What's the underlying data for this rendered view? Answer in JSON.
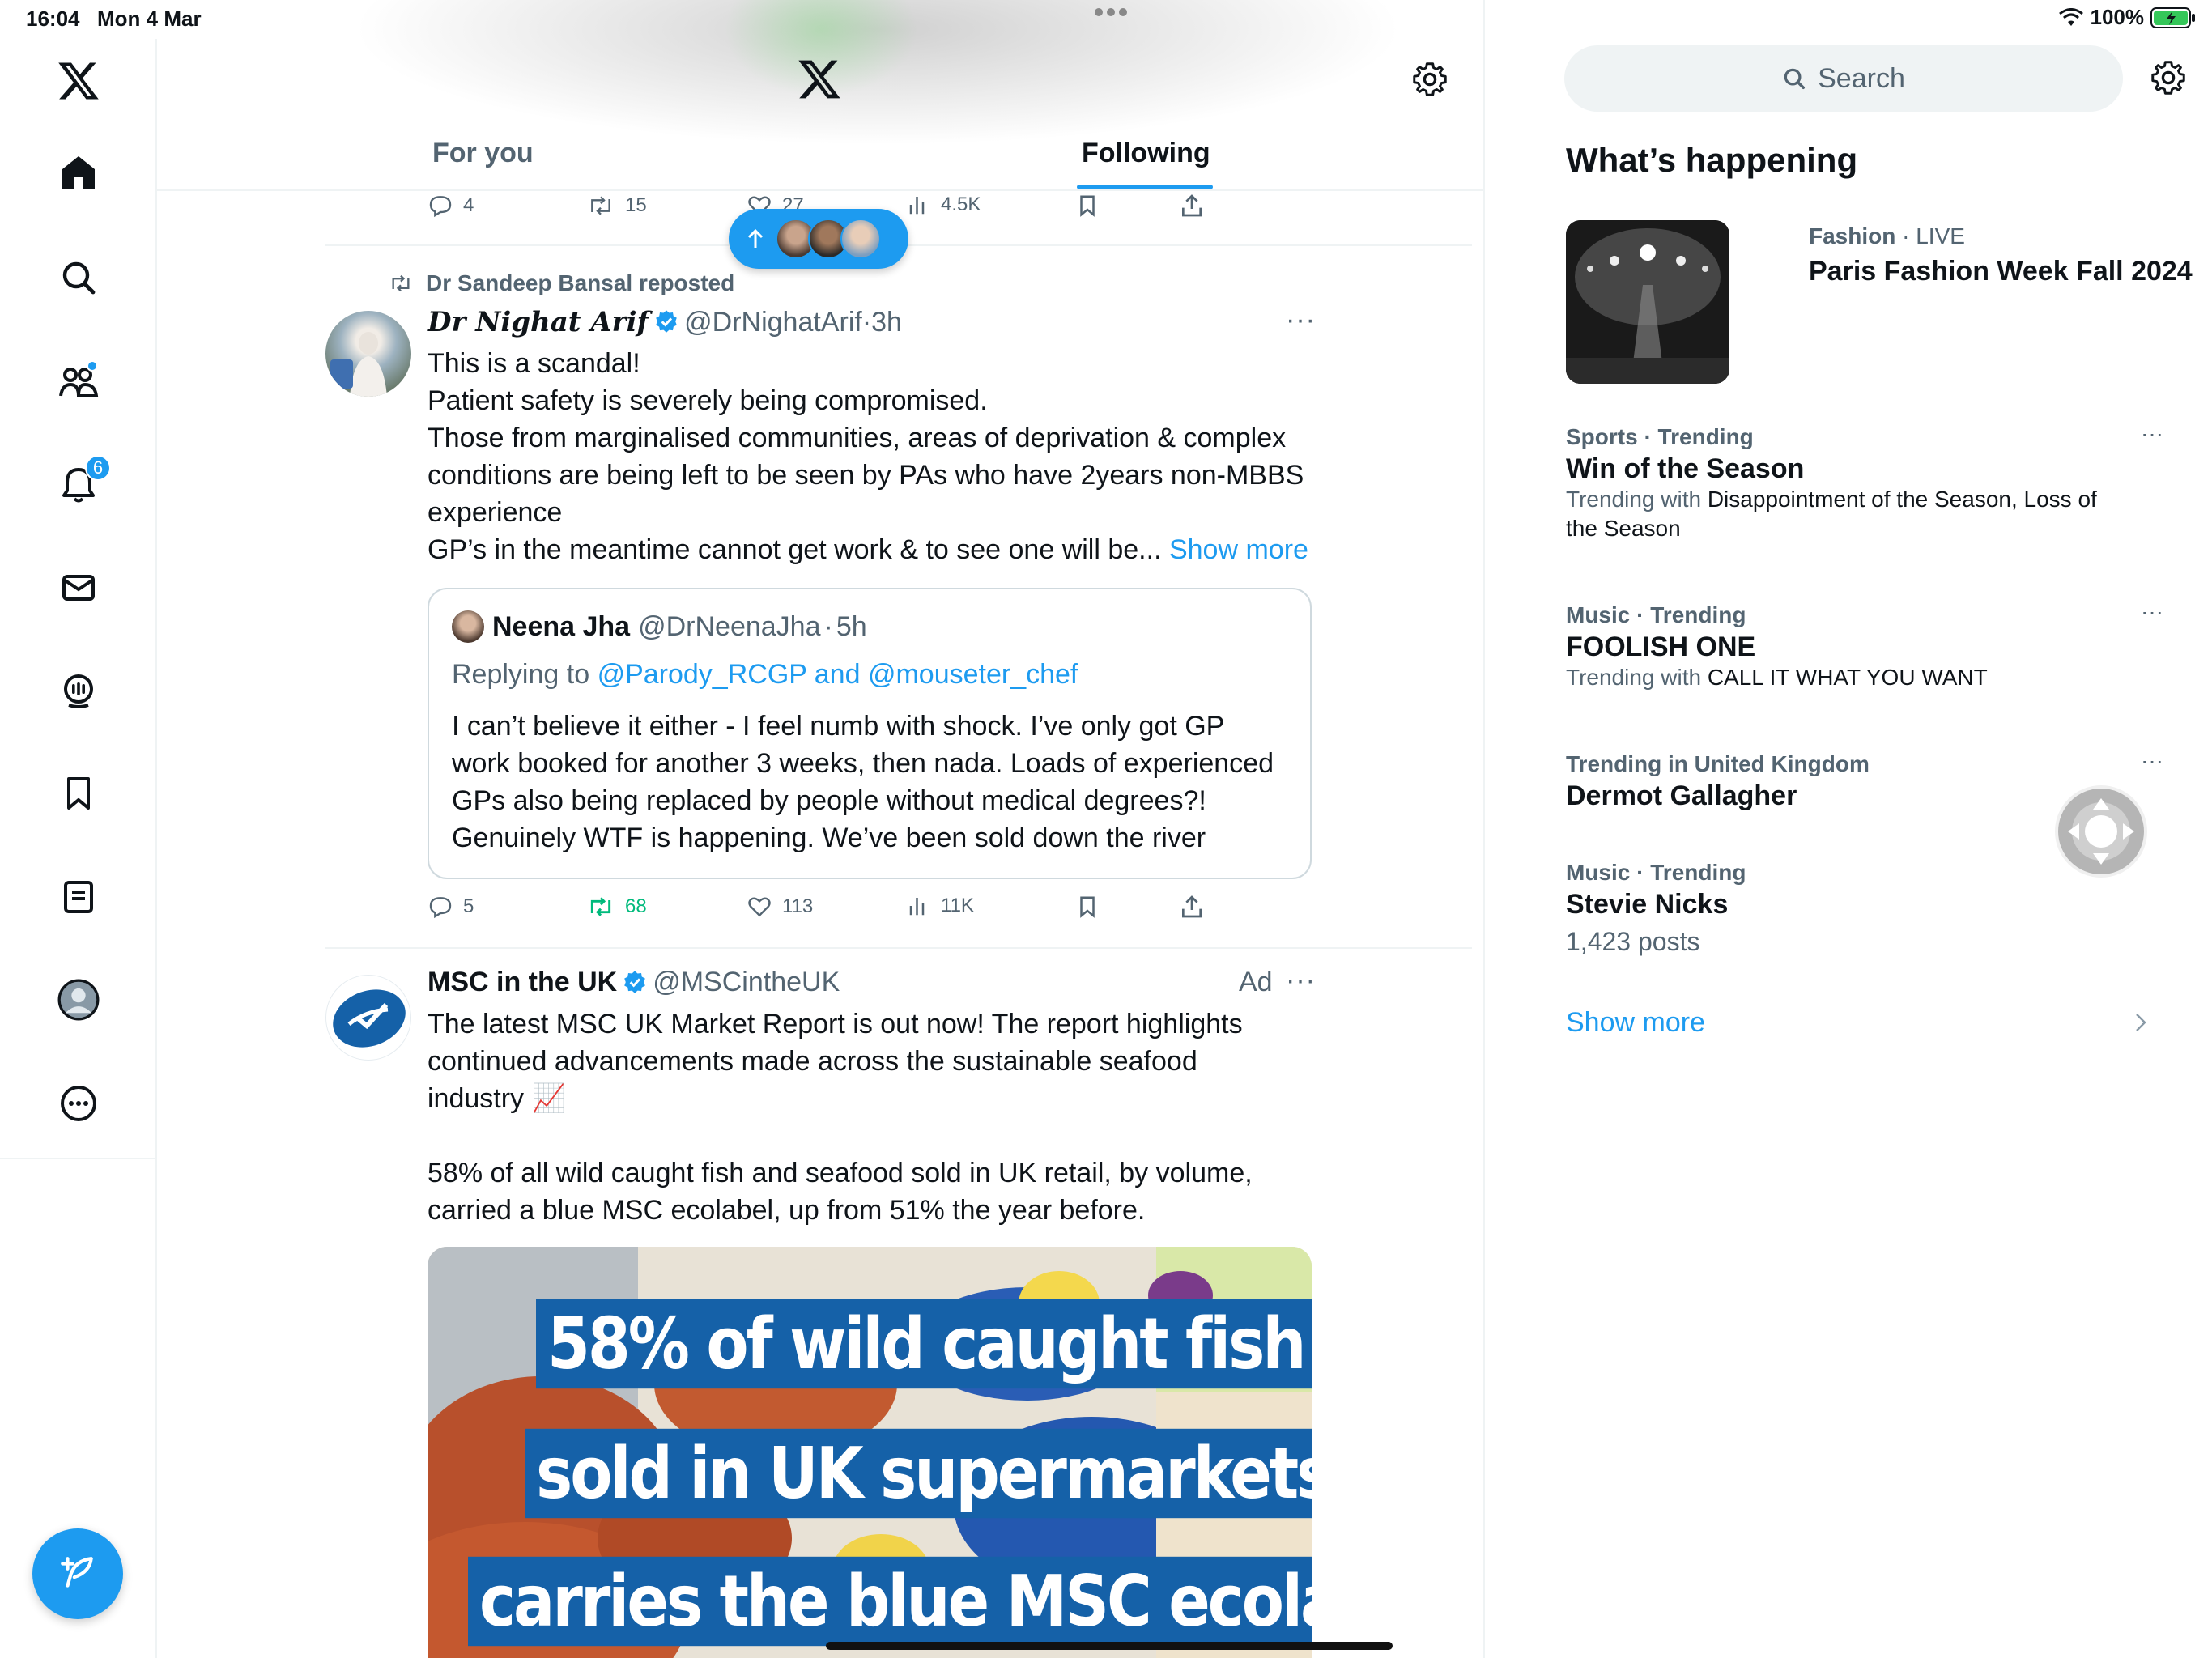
{
  "status_bar": {
    "time": "16:04",
    "date": "Mon 4 Mar",
    "battery": "100%"
  },
  "nav": {
    "notifications_badge": "6"
  },
  "header": {
    "tabs": [
      {
        "label": "For you",
        "selected": false
      },
      {
        "label": "Following",
        "selected": true
      }
    ]
  },
  "feed": {
    "prev_actions": {
      "replies": "4",
      "reposts": "15",
      "likes": "27",
      "views": "4.5K"
    },
    "tweet1": {
      "repost_label": "Dr Sandeep Bansal reposted",
      "name": "Dr Nighat Arif",
      "handle": "@DrNighatArif",
      "time": "3h",
      "lines": [
        "This is a scandal!",
        "Patient safety is severely being compromised.",
        "Those from marginalised communities, areas of deprivation & complex",
        "conditions are being left to be seen by PAs who have 2years non-MBBS",
        "experience",
        "GP’s in the meantime cannot get work & to see one will be..."
      ],
      "show_more": "Show more",
      "quote": {
        "name": "Neena Jha",
        "handle": "@DrNeenaJha",
        "time": "5h",
        "replying_prefix": "Replying to",
        "replying_to": "@Parody_RCGP and @mouseter_chef",
        "lines": [
          "I can’t believe it either - I feel numb with shock. I’ve only got GP",
          "work booked for another 3 weeks, then nada. Loads of experienced",
          "GPs also being replaced by people without medical degrees?!",
          "Genuinely WTF is happening. We’ve been sold down the river"
        ]
      },
      "actions": {
        "replies": "5",
        "reposts": "68",
        "likes": "113",
        "views": "11K"
      }
    },
    "tweet2": {
      "name": "MSC in the UK",
      "handle": "@MSCintheUK",
      "ad_label": "Ad",
      "lines": [
        "The latest MSC UK Market Report is out now! The report highlights",
        "continued advancements made across the sustainable seafood",
        "industry 📈",
        "",
        "58% of all wild caught fish and seafood sold in UK retail, by volume,",
        "carried a blue MSC ecolabel, up from 51% the year before."
      ],
      "image_text": [
        "58% of wild caught fish",
        "sold in UK supermarkets",
        "carries the blue MSC ecolabel"
      ]
    }
  },
  "right": {
    "search_placeholder": "Search",
    "title": "What’s happening",
    "trends": [
      {
        "category": "Fashion",
        "suffix": "LIVE",
        "title": "Paris Fashion Week Fall 2024"
      },
      {
        "category": "Sports · Trending",
        "title": "Win of the Season",
        "sub_prefix": "Trending with",
        "sub": "Disappointment of the Season, Loss of the Season"
      },
      {
        "category": "Music · Trending",
        "title": "FOOLISH ONE",
        "sub_prefix": "Trending with",
        "sub": "CALL IT WHAT YOU WANT"
      },
      {
        "category": "Trending in United Kingdom",
        "title": "Dermot Gallagher"
      },
      {
        "category": "Music · Trending",
        "title": "Stevie Nicks",
        "posts": "1,423 posts"
      }
    ],
    "show_more": "Show more"
  },
  "colors": {
    "accent": "#1d9bf0",
    "text": "#0f1419",
    "muted": "#536471",
    "repost_green": "#00ba7c"
  }
}
